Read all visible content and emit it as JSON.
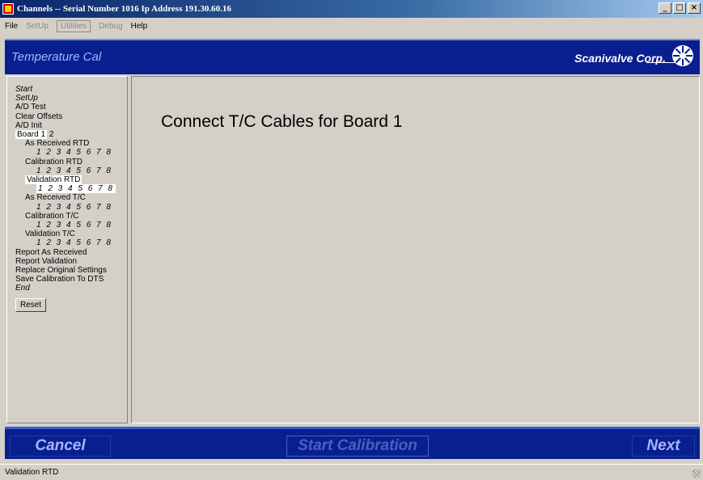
{
  "window": {
    "title": "Channels -- Serial Number 1016  Ip Address 191.30.60.16",
    "minimize": "_",
    "maximize": "□",
    "close": "×"
  },
  "menu": [
    "File",
    "SetUp",
    "Utilities",
    "Debug",
    "Help"
  ],
  "header": {
    "title": "Temperature Cal",
    "brand": "Scanivalve Corp."
  },
  "sidebar": {
    "start": "Start",
    "setup": "SetUp",
    "ad_test": "A/D Test",
    "clear_offsets": "Clear Offsets",
    "ad_init": "A/D Init",
    "board_label": "Board",
    "board_1": "1",
    "board_2": "2",
    "as_received_rtd": "As Received RTD",
    "calibration_rtd": "Calibration RTD",
    "validation_rtd": "Validation RTD",
    "as_received_tc": "As Received T/C",
    "calibration_tc": "Calibration T/C",
    "validation_tc": "Validation T/C",
    "channels": "1 2 3 4 5 6 7 8",
    "report_as_received": "Report As Received",
    "report_validation": "Report Validation",
    "replace_original": "Replace Original Settings",
    "save_calibration": "Save Calibration To DTS",
    "end": "End",
    "reset": "Reset"
  },
  "main": {
    "message": "Connect T/C Cables for Board 1"
  },
  "footer": {
    "cancel": "Cancel",
    "start_calibration": "Start Calibration",
    "next": "Next"
  },
  "status": {
    "text": "Validation RTD"
  }
}
